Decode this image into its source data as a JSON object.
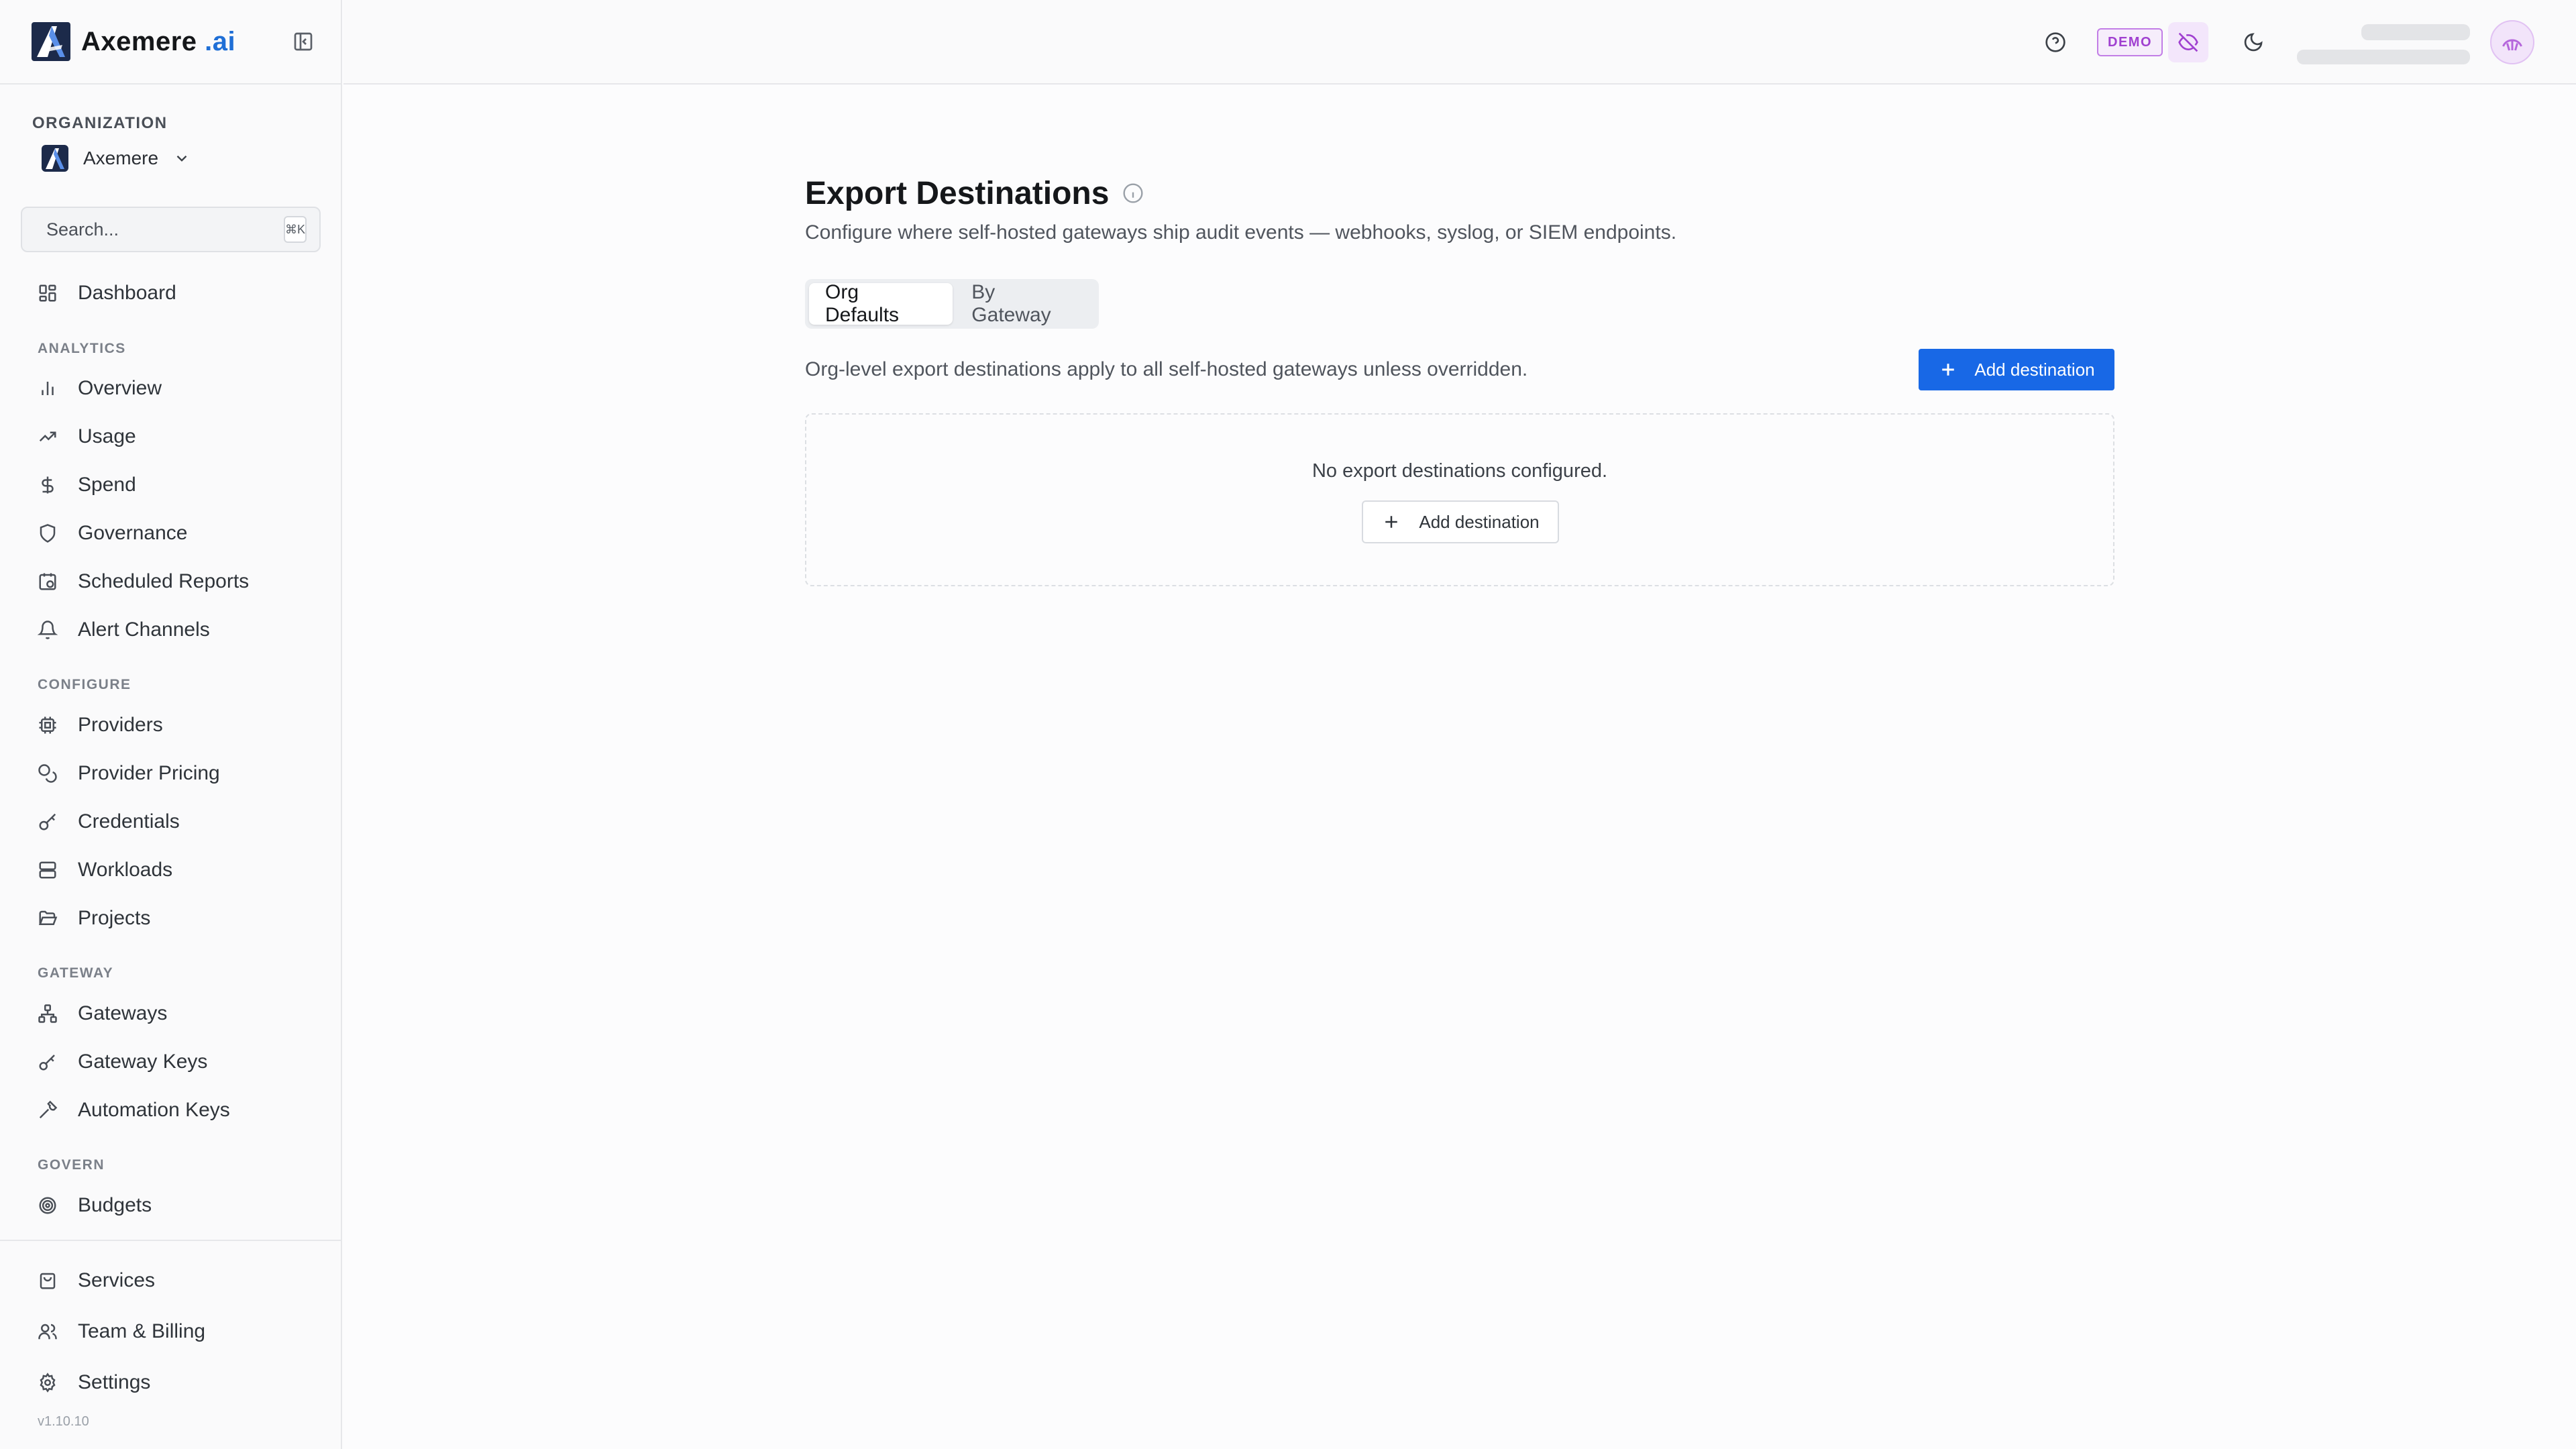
{
  "brand": {
    "name": "Axemere",
    "suffix": " .ai"
  },
  "sidebar": {
    "org_label": "ORGANIZATION",
    "org_name": "Axemere",
    "search_placeholder": "Search...",
    "search_shortcut": "⌘K",
    "dashboard": "Dashboard",
    "sections": {
      "analytics": "ANALYTICS",
      "configure": "CONFIGURE",
      "gateway": "GATEWAY",
      "govern": "GOVERN"
    },
    "items": {
      "overview": "Overview",
      "usage": "Usage",
      "spend": "Spend",
      "governance": "Governance",
      "scheduled_reports": "Scheduled Reports",
      "alert_channels": "Alert Channels",
      "providers": "Providers",
      "provider_pricing": "Provider Pricing",
      "credentials": "Credentials",
      "workloads": "Workloads",
      "projects": "Projects",
      "gateways": "Gateways",
      "gateway_keys": "Gateway Keys",
      "automation_keys": "Automation Keys",
      "budgets": "Budgets"
    },
    "bottom": {
      "services": "Services",
      "team_billing": "Team & Billing",
      "settings": "Settings"
    },
    "version": "v1.10.10"
  },
  "topbar": {
    "demo_badge": "DEMO",
    "icons": [
      "help-icon",
      "eye-off-icon",
      "moon-icon"
    ]
  },
  "main": {
    "title": "Export Destinations",
    "subtitle": "Configure where self-hosted gateways ship audit events — webhooks, syslog, or SIEM endpoints.",
    "tabs": [
      {
        "label": "Org Defaults",
        "active": true
      },
      {
        "label": "By Gateway",
        "active": false
      }
    ],
    "info": "Org-level export destinations apply to all self-hosted gateways unless overridden.",
    "add_button": "Add destination",
    "empty_text": "No export destinations configured.",
    "empty_button": "Add destination"
  },
  "colors": {
    "primary": "#1868e6",
    "brand_ai": "#1f6fd6",
    "demo": "#a040d0"
  }
}
